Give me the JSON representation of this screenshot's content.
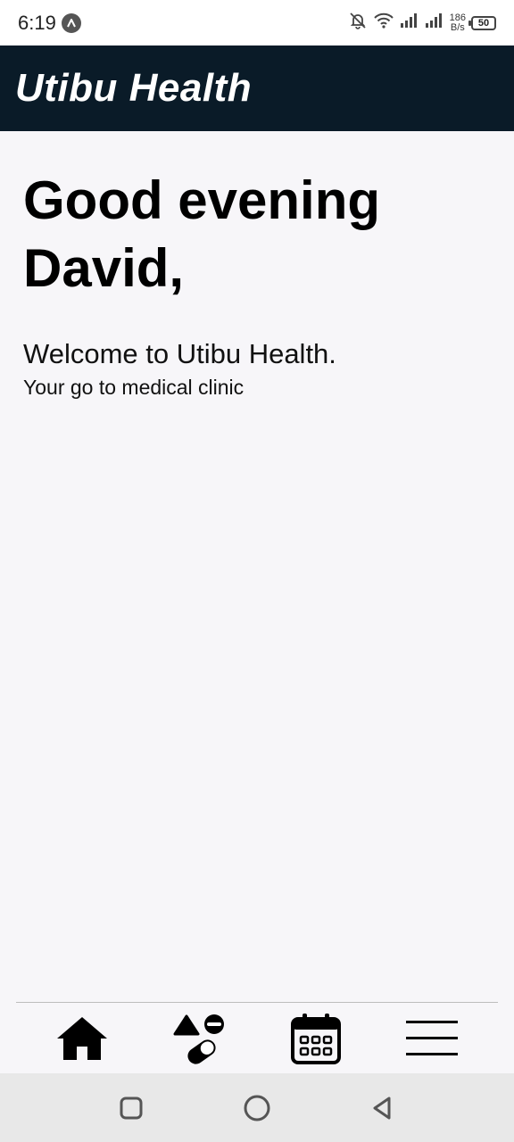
{
  "status_bar": {
    "time": "6:19",
    "speed_value": "186",
    "speed_unit": "B/s",
    "battery": "50"
  },
  "app_bar": {
    "title": "Utibu Health",
    "background": "#0a1b28"
  },
  "home": {
    "greeting_line1": "Good evening",
    "greeting_line2": "David,",
    "welcome": "Welcome to Utibu Health.",
    "tagline": "Your go to medical clinic"
  },
  "bottom_nav": {
    "items": [
      {
        "icon": "home-icon"
      },
      {
        "icon": "medication-icon"
      },
      {
        "icon": "calendar-icon"
      },
      {
        "icon": "menu-icon"
      }
    ]
  },
  "system_nav": {
    "buttons": [
      "recents",
      "home",
      "back"
    ]
  }
}
